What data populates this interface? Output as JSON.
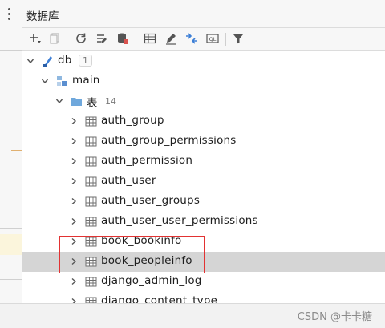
{
  "panel": {
    "title": "数据库"
  },
  "toolbar": {
    "buttons": [
      {
        "name": "add-button",
        "icon": "plus-icon"
      },
      {
        "name": "copy-button",
        "icon": "copy-icon"
      },
      {
        "name": "refresh-button",
        "icon": "refresh-icon"
      },
      {
        "name": "data-source-properties-button",
        "icon": "wrench-icon"
      },
      {
        "name": "database-button",
        "icon": "database-icon"
      },
      {
        "name": "table-view-button",
        "icon": "table-icon"
      },
      {
        "name": "edit-button",
        "icon": "pencil-icon"
      },
      {
        "name": "jump-button",
        "icon": "arrows-icon"
      },
      {
        "name": "query-console-button",
        "icon": "ql-console-icon"
      },
      {
        "name": "filter-button",
        "icon": "funnel-icon"
      }
    ],
    "ql_label": "QL"
  },
  "tree": {
    "db": {
      "label": "db",
      "count": "1"
    },
    "schema": {
      "label": "main"
    },
    "tables_folder": {
      "label": "表",
      "count": "14"
    },
    "tables": [
      {
        "label": "auth_group"
      },
      {
        "label": "auth_group_permissions"
      },
      {
        "label": "auth_permission"
      },
      {
        "label": "auth_user"
      },
      {
        "label": "auth_user_groups"
      },
      {
        "label": "auth_user_user_permissions"
      },
      {
        "label": "book_bookinfo"
      },
      {
        "label": "book_peopleinfo"
      },
      {
        "label": "django_admin_log"
      },
      {
        "label": "django_content_type"
      }
    ]
  },
  "watermark": "CSDN @卡卡糖",
  "colors": {
    "selected_row": "#d5d5d5",
    "highlight_box": "#e23232",
    "db_icon": "#3d7fd6",
    "folder_icon": "#6fa8dc"
  }
}
